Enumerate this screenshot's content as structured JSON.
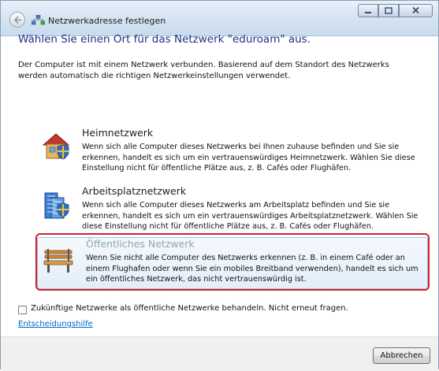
{
  "window": {
    "title": "Netzwerkadresse festlegen"
  },
  "heading": "Wählen Sie einen Ort für das Netzwerk \"eduroam\" aus.",
  "description": "Der Computer ist mit einem Netzwerk verbunden. Basierend auf dem Standort des Netzwerks werden automatisch die richtigen Netzwerkeinstellungen verwendet.",
  "options": [
    {
      "title": "Heimnetzwerk",
      "text": "Wenn sich alle Computer dieses Netzwerks bei Ihnen zuhause befinden und Sie sie erkennen, handelt es sich um ein vertrauenswürdiges Heimnetzwerk. Wählen Sie diese Einstellung nicht für öffentliche Plätze aus, z. B. Cafés oder Flughäfen.",
      "icon": "house-icon"
    },
    {
      "title": "Arbeitsplatznetzwerk",
      "text": "Wenn sich alle Computer dieses Netzwerks am Arbeitsplatz befinden und Sie sie erkennen, handelt es sich um ein vertrauenswürdiges Arbeitsplatznetzwerk. Wählen Sie diese Einstellung nicht für öffentliche Plätze aus, z. B. Cafés oder Flughäfen.",
      "icon": "office-building-icon"
    },
    {
      "title": "Öffentliches Netzwerk",
      "text": "Wenn Sie nicht alle Computer des Netzwerks erkennen (z. B. in einem Café oder an einem Flughafen oder wenn Sie ein mobiles Breitband verwenden), handelt es sich um ein öffentliches Netzwerk, das nicht vertrauenswürdig ist.",
      "icon": "park-bench-icon",
      "selected": true
    }
  ],
  "checkbox": {
    "label": "Zukünftige Netzwerke als öffentliche Netzwerke behandeln. Nicht erneut fragen.",
    "checked": false
  },
  "help_link": "Entscheidungshilfe",
  "buttons": {
    "cancel": "Abbrechen"
  },
  "colors": {
    "heading": "#1e3287",
    "highlight_border": "#d6202a",
    "link": "#0066cc"
  }
}
